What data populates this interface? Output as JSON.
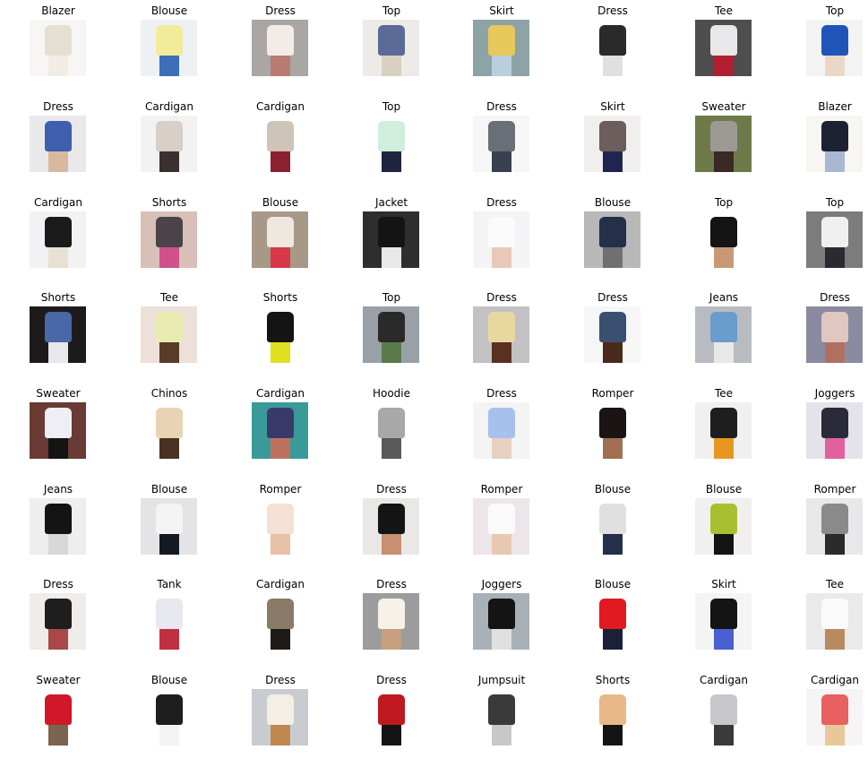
{
  "figure": {
    "rows": 8,
    "cols": 8,
    "items": [
      {
        "label": "Blazer",
        "thumb": "woman-cream-blazer",
        "bg": "#f7f6f4",
        "fg": "#e6e0d2",
        "accent": "#f2ede4"
      },
      {
        "label": "Blouse",
        "thumb": "yellow-blouse-blue-jeans",
        "bg": "#eef1f4",
        "fg": "#f2ec9a",
        "accent": "#3c6fb8"
      },
      {
        "label": "Dress",
        "thumb": "white-floral-dress",
        "bg": "#a9a6a4",
        "fg": "#f1ece8",
        "accent": "#b97b72"
      },
      {
        "label": "Top",
        "thumb": "blue-patterned-top",
        "bg": "#ecebe6",
        "fg": "#5c6a98",
        "accent": "#d8d0c0"
      },
      {
        "label": "Skirt",
        "thumb": "floral-skirt-yellow-clutch",
        "bg": "#8ea3a8",
        "fg": "#e8c85a",
        "accent": "#b8d0dc"
      },
      {
        "label": "Dress",
        "thumb": "black-white-striped-dress",
        "bg": "#ffffff",
        "fg": "#2a2a2a",
        "accent": "#e0e0e0"
      },
      {
        "label": "Tee",
        "thumb": "white-graphic-tee",
        "bg": "#4e4e4e",
        "fg": "#e8e8ea",
        "accent": "#b02030"
      },
      {
        "label": "Top",
        "thumb": "blue-draped-top",
        "bg": "#f3f3f3",
        "fg": "#1f55b8",
        "accent": "#e9d8c8"
      },
      {
        "label": "Dress",
        "thumb": "blue-print-dress",
        "bg": "#e9e9eb",
        "fg": "#3e5fae",
        "accent": "#d9b8a0"
      },
      {
        "label": "Cardigan",
        "thumb": "black-white-knit-cardigan",
        "bg": "#f2f2f2",
        "fg": "#d8d0c8",
        "accent": "#3a3030"
      },
      {
        "label": "Cardigan",
        "thumb": "aztec-red-cardigan",
        "bg": "#ffffff",
        "fg": "#cfc4b8",
        "accent": "#8a2030"
      },
      {
        "label": "Top",
        "thumb": "mint-print-sleeveless-top",
        "bg": "#ffffff",
        "fg": "#cfeedd",
        "accent": "#1d2540"
      },
      {
        "label": "Dress",
        "thumb": "grey-maxi-dress",
        "bg": "#f6f6f6",
        "fg": "#6a6e76",
        "accent": "#3a4050"
      },
      {
        "label": "Skirt",
        "thumb": "grey-crop-top-navy-skirt",
        "bg": "#f1efee",
        "fg": "#6b5e5c",
        "accent": "#202450"
      },
      {
        "label": "Sweater",
        "thumb": "grey-knit-sweater",
        "bg": "#6f7a4a",
        "fg": "#9d9a96",
        "accent": "#3a2a24"
      },
      {
        "label": "Blazer",
        "thumb": "navy-blazer-jeans",
        "bg": "#f8f6f2",
        "fg": "#1c2234",
        "accent": "#a8b8d0"
      },
      {
        "label": "Cardigan",
        "thumb": "black-cardigan",
        "bg": "#f2f2f4",
        "fg": "#1a1a1a",
        "accent": "#e8e0d0"
      },
      {
        "label": "Shorts",
        "thumb": "pink-print-shorts",
        "bg": "#d8bfb8",
        "fg": "#4a4448",
        "accent": "#d0508a"
      },
      {
        "label": "Blouse",
        "thumb": "floral-blouse-street",
        "bg": "#a89888",
        "fg": "#efe8e0",
        "accent": "#d83848"
      },
      {
        "label": "Jacket",
        "thumb": "black-outfit-jacket",
        "bg": "#2e2e2e",
        "fg": "#141414",
        "accent": "#e8e8e8"
      },
      {
        "label": "Dress",
        "thumb": "white-skater-dress",
        "bg": "#f4f4f6",
        "fg": "#fbfbfb",
        "accent": "#e8c8b8"
      },
      {
        "label": "Blouse",
        "thumb": "dark-skinny-jeans-street",
        "bg": "#b8b8b8",
        "fg": "#24304a",
        "accent": "#707070"
      },
      {
        "label": "Top",
        "thumb": "black-sleeveless-top",
        "bg": "#ffffff",
        "fg": "#141414",
        "accent": "#c89878"
      },
      {
        "label": "Top",
        "thumb": "white-tank-top",
        "bg": "#7c7c7c",
        "fg": "#f0f0f0",
        "accent": "#2a2a30"
      },
      {
        "label": "Shorts",
        "thumb": "distressed-denim-shorts",
        "bg": "#1e1a1c",
        "fg": "#4868a8",
        "accent": "#e8e8ec"
      },
      {
        "label": "Tee",
        "thumb": "yellow-striped-tee",
        "bg": "#ece0d8",
        "fg": "#e8ecb0",
        "accent": "#5a3a28"
      },
      {
        "label": "Shorts",
        "thumb": "black-athletic-shorts",
        "bg": "#ffffff",
        "fg": "#141414",
        "accent": "#e0e020"
      },
      {
        "label": "Top",
        "thumb": "white-top-black-skirt",
        "bg": "#9aa0a8",
        "fg": "#2a2a2a",
        "accent": "#5a7a4a"
      },
      {
        "label": "Dress",
        "thumb": "patterned-mini-dress",
        "bg": "#c2c2c4",
        "fg": "#e8d8a0",
        "accent": "#5a3020"
      },
      {
        "label": "Dress",
        "thumb": "denim-print-dress",
        "bg": "#f6f6f6",
        "fg": "#3a5070",
        "accent": "#4a2a1a"
      },
      {
        "label": "Jeans",
        "thumb": "ripped-light-jeans",
        "bg": "#b8bcc0",
        "fg": "#6a9ccc",
        "accent": "#e8e8e8"
      },
      {
        "label": "Dress",
        "thumb": "floral-print-dress",
        "bg": "#8a8aa0",
        "fg": "#e0c8c0",
        "accent": "#b07060"
      },
      {
        "label": "Sweater",
        "thumb": "white-vneck-sweater",
        "bg": "#6a3a34",
        "fg": "#eeeef4",
        "accent": "#141414"
      },
      {
        "label": "Chinos",
        "thumb": "khaki-chinos",
        "bg": "#ffffff",
        "fg": "#e8d4b4",
        "accent": "#4a3020"
      },
      {
        "label": "Cardigan",
        "thumb": "plaid-cardigan-collage",
        "bg": "#3a9a9a",
        "fg": "#3a3a6a",
        "accent": "#c07060"
      },
      {
        "label": "Hoodie",
        "thumb": "grey-zip-hoodie",
        "bg": "#ffffff",
        "fg": "#a8a8a8",
        "accent": "#5a5a5a"
      },
      {
        "label": "Dress",
        "thumb": "light-blue-dress",
        "bg": "#f4f4f4",
        "fg": "#a8c0ec",
        "accent": "#e8d0c0"
      },
      {
        "label": "Romper",
        "thumb": "black-romper",
        "bg": "#ffffff",
        "fg": "#1a1414",
        "accent": "#a07050"
      },
      {
        "label": "Tee",
        "thumb": "fashion-collage-leather",
        "bg": "#f0f0f0",
        "fg": "#1e1e1e",
        "accent": "#e89820"
      },
      {
        "label": "Joggers",
        "thumb": "printed-joggers",
        "bg": "#e4e2ea",
        "fg": "#2a2a3a",
        "accent": "#e060a0"
      },
      {
        "label": "Jeans",
        "thumb": "black-jeans",
        "bg": "#eeeeee",
        "fg": "#141414",
        "accent": "#d8d8d8"
      },
      {
        "label": "Blouse",
        "thumb": "white-blouse-flare-jeans",
        "bg": "#e4e4e6",
        "fg": "#f4f4f4",
        "accent": "#141a24"
      },
      {
        "label": "Romper",
        "thumb": "blush-romper",
        "bg": "#ffffff",
        "fg": "#f4e0d4",
        "accent": "#e8c0a8"
      },
      {
        "label": "Dress",
        "thumb": "black-lace-dress",
        "bg": "#eae8e6",
        "fg": "#141414",
        "accent": "#c89070"
      },
      {
        "label": "Romper",
        "thumb": "white-halter-romper",
        "bg": "#ece6ea",
        "fg": "#fafafa",
        "accent": "#e8c8b0"
      },
      {
        "label": "Blouse",
        "thumb": "outfit-flatlay",
        "bg": "#ffffff",
        "fg": "#e0e0e0",
        "accent": "#24304a"
      },
      {
        "label": "Blouse",
        "thumb": "green-print-blouse",
        "bg": "#f2f0ee",
        "fg": "#a8c030",
        "accent": "#141414"
      },
      {
        "label": "Romper",
        "thumb": "gingham-romper",
        "bg": "#e8e8ea",
        "fg": "#8a8a8a",
        "accent": "#2a2a2a"
      },
      {
        "label": "Dress",
        "thumb": "red-pattern-dress-leather",
        "bg": "#f0ecea",
        "fg": "#1e1e1e",
        "accent": "#a84848"
      },
      {
        "label": "Tank",
        "thumb": "striped-tank",
        "bg": "#ffffff",
        "fg": "#e8e8f0",
        "accent": "#c03040"
      },
      {
        "label": "Cardigan",
        "thumb": "leopard-cardigan",
        "bg": "#ffffff",
        "fg": "#8a7a68",
        "accent": "#1e1a18"
      },
      {
        "label": "Dress",
        "thumb": "cream-sleeveless-dress",
        "bg": "#9c9c9c",
        "fg": "#f6f2e8",
        "accent": "#c8a080"
      },
      {
        "label": "Joggers",
        "thumb": "print-joggers-crop",
        "bg": "#a8b0b8",
        "fg": "#141414",
        "accent": "#e0e0e0"
      },
      {
        "label": "Blouse",
        "thumb": "red-swing-blouse",
        "bg": "#ffffff",
        "fg": "#e01a20",
        "accent": "#1a2038"
      },
      {
        "label": "Skirt",
        "thumb": "black-top-blue-skirt",
        "bg": "#f4f4f4",
        "fg": "#141414",
        "accent": "#4a60d0"
      },
      {
        "label": "Tee",
        "thumb": "white-muscle-tee",
        "bg": "#eaeaea",
        "fg": "#fafafa",
        "accent": "#b88a60"
      },
      {
        "label": "Sweater",
        "thumb": "red-sweater-hat",
        "bg": "#ffffff",
        "fg": "#d01828",
        "accent": "#7a6450"
      },
      {
        "label": "Blouse",
        "thumb": "black-shrug-hanger",
        "bg": "#ffffff",
        "fg": "#1e1e1e",
        "accent": "#f4f4f4"
      },
      {
        "label": "Dress",
        "thumb": "white-maxi-dress",
        "bg": "#c8ccd0",
        "fg": "#f4efe4",
        "accent": "#c08850"
      },
      {
        "label": "Dress",
        "thumb": "red-plaid-shirt",
        "bg": "#ffffff",
        "fg": "#c01820",
        "accent": "#141414"
      },
      {
        "label": "Jumpsuit",
        "thumb": "print-jumpsuit",
        "bg": "#ffffff",
        "fg": "#3a3a3a",
        "accent": "#c8c8c8"
      },
      {
        "label": "Shorts",
        "thumb": "legs-sandals",
        "bg": "#ffffff",
        "fg": "#e8b888",
        "accent": "#141414"
      },
      {
        "label": "Cardigan",
        "thumb": "long-grey-cardigan",
        "bg": "#ffffff",
        "fg": "#c8c8cc",
        "accent": "#3a3a3a"
      },
      {
        "label": "Cardigan",
        "thumb": "coral-tee",
        "bg": "#f6f4f4",
        "fg": "#e86060",
        "accent": "#e8c898"
      }
    ]
  }
}
